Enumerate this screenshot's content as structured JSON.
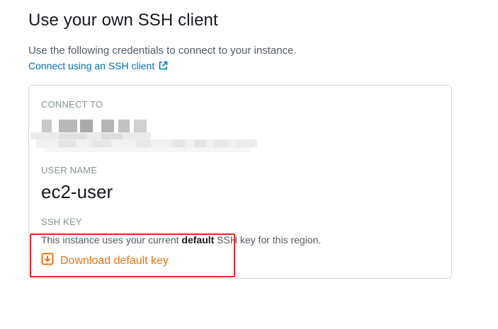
{
  "section": {
    "title": "Use your own SSH client",
    "description": "Use the following credentials to connect to your instance.",
    "link_label": "Connect using an SSH client"
  },
  "card": {
    "connect_to": {
      "label": "CONNECT TO"
    },
    "user_name": {
      "label": "USER NAME",
      "value": "ec2-user"
    },
    "ssh_key": {
      "label": "SSH KEY",
      "desc_before": "This instance uses your current ",
      "desc_bold": "default",
      "desc_after": " SSH key for this region.",
      "download_label": "Download default key"
    }
  },
  "icons": {
    "external_link": "external-link-icon",
    "download": "download-icon"
  },
  "colors": {
    "link": "#0073bb",
    "download_accent": "#ec7211",
    "highlight": "#e8262b",
    "card_border": "#d5dbdb"
  }
}
